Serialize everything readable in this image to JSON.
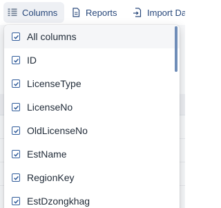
{
  "toolbar": {
    "columns_label": "Columns",
    "columns_icon": "columns-icon",
    "reports_label": "Reports",
    "reports_icon": "report-icon",
    "import_label": "Import Data",
    "import_icon": "import-icon"
  },
  "menu": {
    "items": [
      {
        "label": "All columns",
        "checked": true
      },
      {
        "label": "ID",
        "checked": true
      },
      {
        "label": "LicenseType",
        "checked": true
      },
      {
        "label": "LicenseNo",
        "checked": true
      },
      {
        "label": "OldLicenseNo",
        "checked": true
      },
      {
        "label": "EstName",
        "checked": true
      },
      {
        "label": "RegionKey",
        "checked": true
      },
      {
        "label": "EstDzongkhag",
        "checked": true
      }
    ]
  },
  "colors": {
    "accent": "#2f5b9a",
    "toolbar_text": "#27477a",
    "menu_text": "#1f2a37",
    "scrollbar": "#6f8db8"
  }
}
